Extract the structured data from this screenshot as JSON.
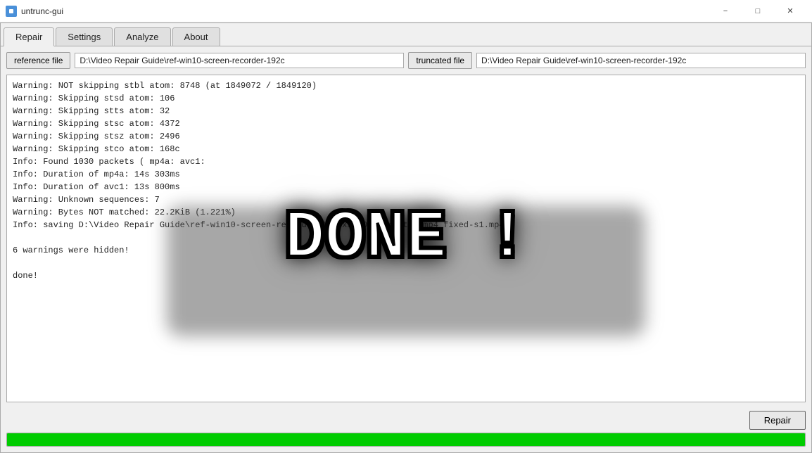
{
  "titleBar": {
    "icon": "app-icon",
    "title": "untrunc-gui",
    "minimize": "−",
    "maximize": "□",
    "close": "✕"
  },
  "tabs": [
    {
      "id": "repair",
      "label": "Repair",
      "active": true
    },
    {
      "id": "settings",
      "label": "Settings",
      "active": false
    },
    {
      "id": "analyze",
      "label": "Analyze",
      "active": false
    },
    {
      "id": "about",
      "label": "About",
      "active": false
    }
  ],
  "referenceFile": {
    "buttonLabel": "reference file",
    "path": "D:\\Video Repair Guide\\ref-win10-screen-recorder-192c"
  },
  "truncatedFile": {
    "buttonLabel": "truncated file",
    "path": "D:\\Video Repair Guide\\ref-win10-screen-recorder-192c"
  },
  "logLines": [
    "Warning: NOT skipping stbl atom: 8748 (at 1849072 / 1849120)",
    "Warning: Skipping stsd atom: 106",
    "Warning: Skipping stts atom: 32",
    "Warning: Skipping stsc atom: 4372",
    "Warning: Skipping stsz atom: 2496",
    "Warning: Skipping stco atom: 168c",
    "Info: Found 1030 packets ( mp4a: avc1:",
    "Info: Duration of mp4a: 14s 303ms",
    "Info: Duration of avc1: 13s 800ms",
    "Warning: Unknown sequences: 7",
    "Warning: Bytes NOT matched: 22.2KiB (1.221%)",
    "Info: saving D:\\Video Repair Guide\\ref-win10-screen-recorder-1920x1080-corrupted.mp4_fixed-s1.mp4",
    "",
    "6 warnings were hidden!",
    "",
    "done!"
  ],
  "doneText": "DONE !",
  "repairButton": {
    "label": "Repair"
  },
  "progressBar": {
    "value": 100,
    "color": "#00cc00"
  }
}
